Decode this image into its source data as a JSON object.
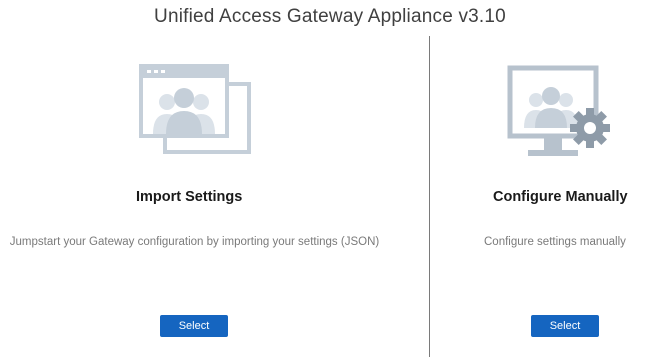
{
  "page": {
    "title": "Unified Access Gateway Appliance v3.10"
  },
  "options": [
    {
      "title": "Import Settings",
      "description": "Jumpstart your Gateway configuration by importing your settings (JSON)",
      "button_label": "Select",
      "icon": "import-settings-icon"
    },
    {
      "title": "Configure Manually",
      "description": "Configure settings manually",
      "button_label": "Select",
      "icon": "configure-manually-icon"
    }
  ],
  "colors": {
    "accent": "#1565c0",
    "icon_fill": "#c5cfd9",
    "icon_frame": "#b7c2cd",
    "divider": "#7a7a7a"
  }
}
